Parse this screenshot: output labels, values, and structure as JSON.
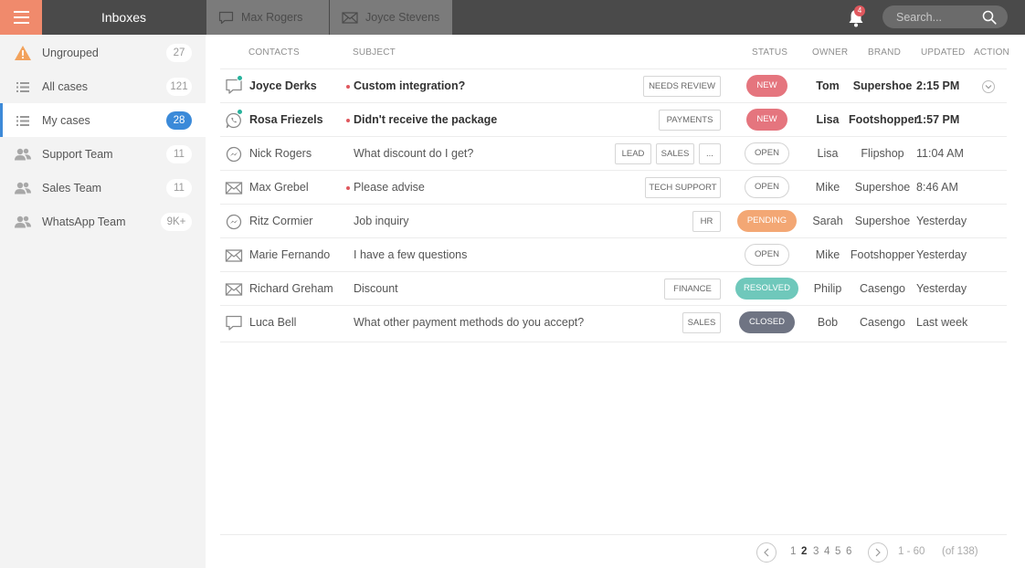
{
  "header": {
    "title": "Inboxes",
    "tabs": [
      {
        "label": "Max Rogers",
        "icon": "chat-bubble-icon"
      },
      {
        "label": "Joyce Stevens",
        "icon": "envelope-icon"
      }
    ],
    "notifications_count": "4",
    "search_placeholder": "Search..."
  },
  "sidebar": {
    "items": [
      {
        "label": "Ungrouped",
        "count": "27",
        "icon": "warning-icon"
      },
      {
        "label": "All cases",
        "count": "121",
        "icon": "list-icon"
      },
      {
        "label": "My cases",
        "count": "28",
        "icon": "list-icon",
        "active": true
      },
      {
        "label": "Support Team",
        "count": "11",
        "icon": "team-icon"
      },
      {
        "label": "Sales Team",
        "count": "11",
        "icon": "team-icon"
      },
      {
        "label": "WhatsApp Team",
        "count": "9K+",
        "icon": "team-icon"
      }
    ]
  },
  "table": {
    "columns": {
      "contacts": "CONTACTS",
      "subject": "SUBJECT",
      "status": "STATUS",
      "owner": "OWNER",
      "brand": "BRAND",
      "updated": "UPDATED",
      "action": "ACTION"
    },
    "rows": [
      {
        "channel": "chat-bubble-icon",
        "online": true,
        "contact": "Joyce Derks",
        "unread": true,
        "subject": "Custom integration?",
        "tags": [
          "NEEDS REVIEW"
        ],
        "status": "NEW",
        "owner": "Tom",
        "brand": "Supershoe",
        "updated": "2:15 PM"
      },
      {
        "channel": "whatsapp-icon",
        "online": true,
        "contact": "Rosa Friezels",
        "unread": true,
        "subject": "Didn't receive the package",
        "tags": [
          "PAYMENTS"
        ],
        "status": "NEW",
        "owner": "Lisa",
        "brand": "Footshopper",
        "updated": "1:57 PM"
      },
      {
        "channel": "messenger-icon",
        "online": false,
        "contact": "Nick Rogers",
        "unread": false,
        "subject": "What discount do I get?",
        "tags": [
          "LEAD",
          "SALES",
          "..."
        ],
        "status": "OPEN",
        "owner": "Lisa",
        "brand": "Flipshop",
        "updated": "11:04 AM"
      },
      {
        "channel": "envelope-icon",
        "online": false,
        "contact": "Max Grebel",
        "unread": true,
        "subject": "Please advise",
        "tags": [
          "TECH SUPPORT"
        ],
        "status": "OPEN",
        "owner": "Mike",
        "brand": "Supershoe",
        "updated": "8:46 AM"
      },
      {
        "channel": "messenger-icon",
        "online": false,
        "contact": "Ritz Cormier",
        "unread": false,
        "subject": "Job inquiry",
        "tags": [
          "HR"
        ],
        "status": "PENDING",
        "owner": "Sarah",
        "brand": "Supershoe",
        "updated": "Yesterday"
      },
      {
        "channel": "envelope-icon",
        "online": false,
        "contact": "Marie Fernando",
        "unread": false,
        "subject": "I have a few questions",
        "tags": [],
        "status": "OPEN",
        "owner": "Mike",
        "brand": "Footshopper",
        "updated": "Yesterday"
      },
      {
        "channel": "envelope-icon",
        "online": false,
        "contact": "Richard Greham",
        "unread": false,
        "subject": "Discount",
        "tags": [
          "FINANCE"
        ],
        "status": "RESOLVED",
        "owner": "Philip",
        "brand": "Casengo",
        "updated": "Yesterday"
      },
      {
        "channel": "chat-bubble-icon",
        "online": false,
        "contact": "Luca Bell",
        "unread": false,
        "subject": "What other payment methods do you accept?",
        "tags": [
          "SALES"
        ],
        "status": "CLOSED",
        "owner": "Bob",
        "brand": "Casengo",
        "updated": "Last week"
      }
    ]
  },
  "pagination": {
    "prev": "<",
    "next": ">",
    "pages": [
      "1",
      "2",
      "3",
      "4",
      "5",
      "6"
    ],
    "current": "2",
    "range": "1 - 60",
    "total": "(of 138)"
  },
  "colors": {
    "accent_orange": "#f08a6c",
    "active_blue": "#3b8ad9",
    "new": "#e5757e",
    "pending": "#f3a774",
    "resolved": "#6fc8bb",
    "closed": "#6f7483",
    "online": "#27b29c"
  }
}
